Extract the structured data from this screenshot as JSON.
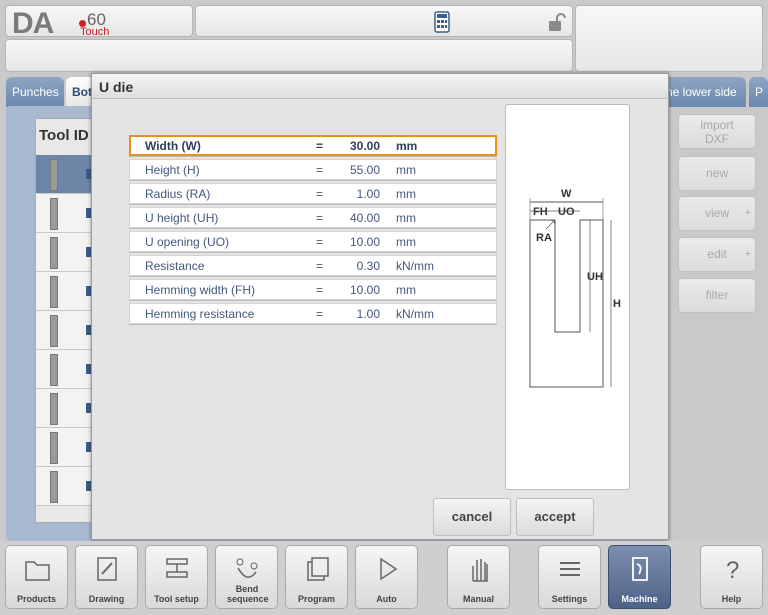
{
  "header": {
    "logo_text": "DA",
    "logo_model": "60",
    "logo_sub": "Touch",
    "icons": [
      "calculator-icon",
      "unlock-icon"
    ]
  },
  "tabs": [
    "Punches",
    "Bot",
    "ne lower side",
    "P"
  ],
  "background": {
    "list_header": "Tool ID",
    "row_count": 9
  },
  "side_buttons": [
    {
      "label": "import DXF"
    },
    {
      "label": "new"
    },
    {
      "label": "view",
      "plus": "+"
    },
    {
      "label": "edit",
      "plus": "+"
    },
    {
      "label": "filter"
    }
  ],
  "dialog": {
    "title": "U die",
    "params": [
      {
        "label": "Width (W)",
        "eq": "=",
        "value": "30.00",
        "unit": "mm",
        "selected": true
      },
      {
        "label": "Height (H)",
        "eq": "=",
        "value": "55.00",
        "unit": "mm"
      },
      {
        "label": "Radius (RA)",
        "eq": "=",
        "value": "1.00",
        "unit": "mm"
      },
      {
        "label": "U height (UH)",
        "eq": "=",
        "value": "40.00",
        "unit": "mm"
      },
      {
        "label": "U opening (UO)",
        "eq": "=",
        "value": "10.00",
        "unit": "mm"
      },
      {
        "label": "Resistance",
        "eq": "=",
        "value": "0.30",
        "unit": "kN/mm"
      },
      {
        "label": "Hemming width (FH)",
        "eq": "=",
        "value": "10.00",
        "unit": "mm"
      },
      {
        "label": "Hemming resistance",
        "eq": "=",
        "value": "1.00",
        "unit": "kN/mm"
      }
    ],
    "diagram_labels": {
      "w": "W",
      "fh": "FH",
      "uo": "UO",
      "ra": "RA",
      "uh": "UH",
      "h": "H"
    },
    "cancel_label": "cancel",
    "accept_label": "accept"
  },
  "bottom_nav": [
    {
      "label": "Products",
      "icon": "folder-icon"
    },
    {
      "label": "Drawing",
      "icon": "drawing-icon"
    },
    {
      "label": "Tool setup",
      "icon": "tool-setup-icon"
    },
    {
      "label": "Bend sequence",
      "icon": "bend-sequence-icon"
    },
    {
      "label": "Program",
      "icon": "program-icon"
    },
    {
      "label": "Auto",
      "icon": "play-icon"
    },
    {
      "label": "Manual",
      "icon": "hand-icon"
    },
    {
      "label": "Settings",
      "icon": "settings-icon"
    },
    {
      "label": "Machine",
      "icon": "machine-icon",
      "active": true
    },
    {
      "label": "Help",
      "icon": "help-icon"
    }
  ]
}
